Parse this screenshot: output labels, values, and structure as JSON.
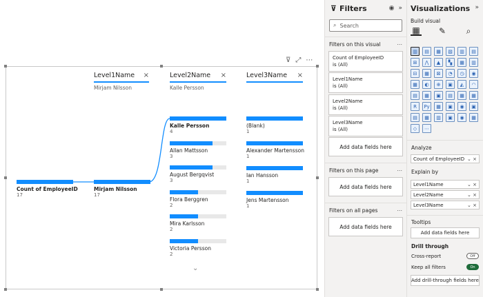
{
  "visual": {
    "toolbar": {
      "filter_icon": "filter-icon",
      "focus_icon": "focus-mode-icon",
      "more_icon": "more-options-icon"
    },
    "levels": [
      {
        "name": "Level1Name",
        "selected": "Mirjam Nilsson"
      },
      {
        "name": "Level2Name",
        "selected": "Kalle Persson"
      },
      {
        "name": "Level3Name",
        "selected": ""
      }
    ],
    "close_glyph": "×",
    "root": {
      "label": "Count of EmployeeID",
      "value": "17",
      "fill": 1.0
    },
    "level1": [
      {
        "label": "Mirjam Nilsson",
        "value": "17",
        "fill": 1.0
      }
    ],
    "level2": [
      {
        "label": "Kalle Persson",
        "value": "4",
        "fill": 1.0
      },
      {
        "label": "Allan Mattsson",
        "value": "3",
        "fill": 0.75
      },
      {
        "label": "August Bergqvist",
        "value": "3",
        "fill": 0.75
      },
      {
        "label": "Flora Berggren",
        "value": "2",
        "fill": 0.5
      },
      {
        "label": "Mira Karlsson",
        "value": "2",
        "fill": 0.5
      },
      {
        "label": "Victoria Persson",
        "value": "2",
        "fill": 0.5
      }
    ],
    "level3": [
      {
        "label": "(Blank)",
        "value": "1",
        "fill": 1.0
      },
      {
        "label": "Alexander Martensson",
        "value": "1",
        "fill": 1.0
      },
      {
        "label": "Ian Hansson",
        "value": "1",
        "fill": 1.0
      },
      {
        "label": "Jens Martensson",
        "value": "1",
        "fill": 1.0
      }
    ],
    "expand_glyph": "⌄"
  },
  "filters": {
    "title": "Filters",
    "search_placeholder": "Search",
    "on_visual": "Filters on this visual",
    "on_page": "Filters on this page",
    "on_all": "Filters on all pages",
    "more": "...",
    "cards": [
      {
        "name": "Count of EmployeeID",
        "state": "is (All)"
      },
      {
        "name": "Level1Name",
        "state": "is (All)"
      },
      {
        "name": "Level2Name",
        "state": "is (All)"
      },
      {
        "name": "Level3Name",
        "state": "is (All)"
      }
    ],
    "add_fields": "Add data fields here"
  },
  "viz": {
    "title": "Visualizations",
    "build_visual": "Build visual",
    "analyze": "Analyze",
    "analyze_field": "Count of EmployeeID",
    "explain_by": "Explain by",
    "explain_fields": [
      "Level1Name",
      "Level2Name",
      "Level3Name"
    ],
    "tooltips": "Tooltips",
    "add_fields": "Add data fields here",
    "drill_through": "Drill through",
    "cross_report": "Cross-report",
    "cross_report_state": "Off",
    "keep_filters": "Keep all filters",
    "keep_filters_state": "On",
    "add_drill": "Add drill-through fields here",
    "gallery": [
      "▥",
      "▤",
      "▦",
      "▧",
      "▥",
      "▤",
      "⊞",
      "⋀",
      "▲",
      "▚",
      "▦",
      "▥",
      "⊟",
      "▦",
      "⊠",
      "◔",
      "◷",
      "◉",
      "▦",
      "◐",
      "⊕",
      "▣",
      "◭",
      "◠",
      "▤",
      "▦",
      "▣",
      "▤",
      "▦",
      "▦",
      "R",
      "Py",
      "▦",
      "▣",
      "◉",
      "▣",
      "▤",
      "▦",
      "▥",
      "▣",
      "◉",
      "▦",
      "◇",
      "⋯"
    ]
  }
}
